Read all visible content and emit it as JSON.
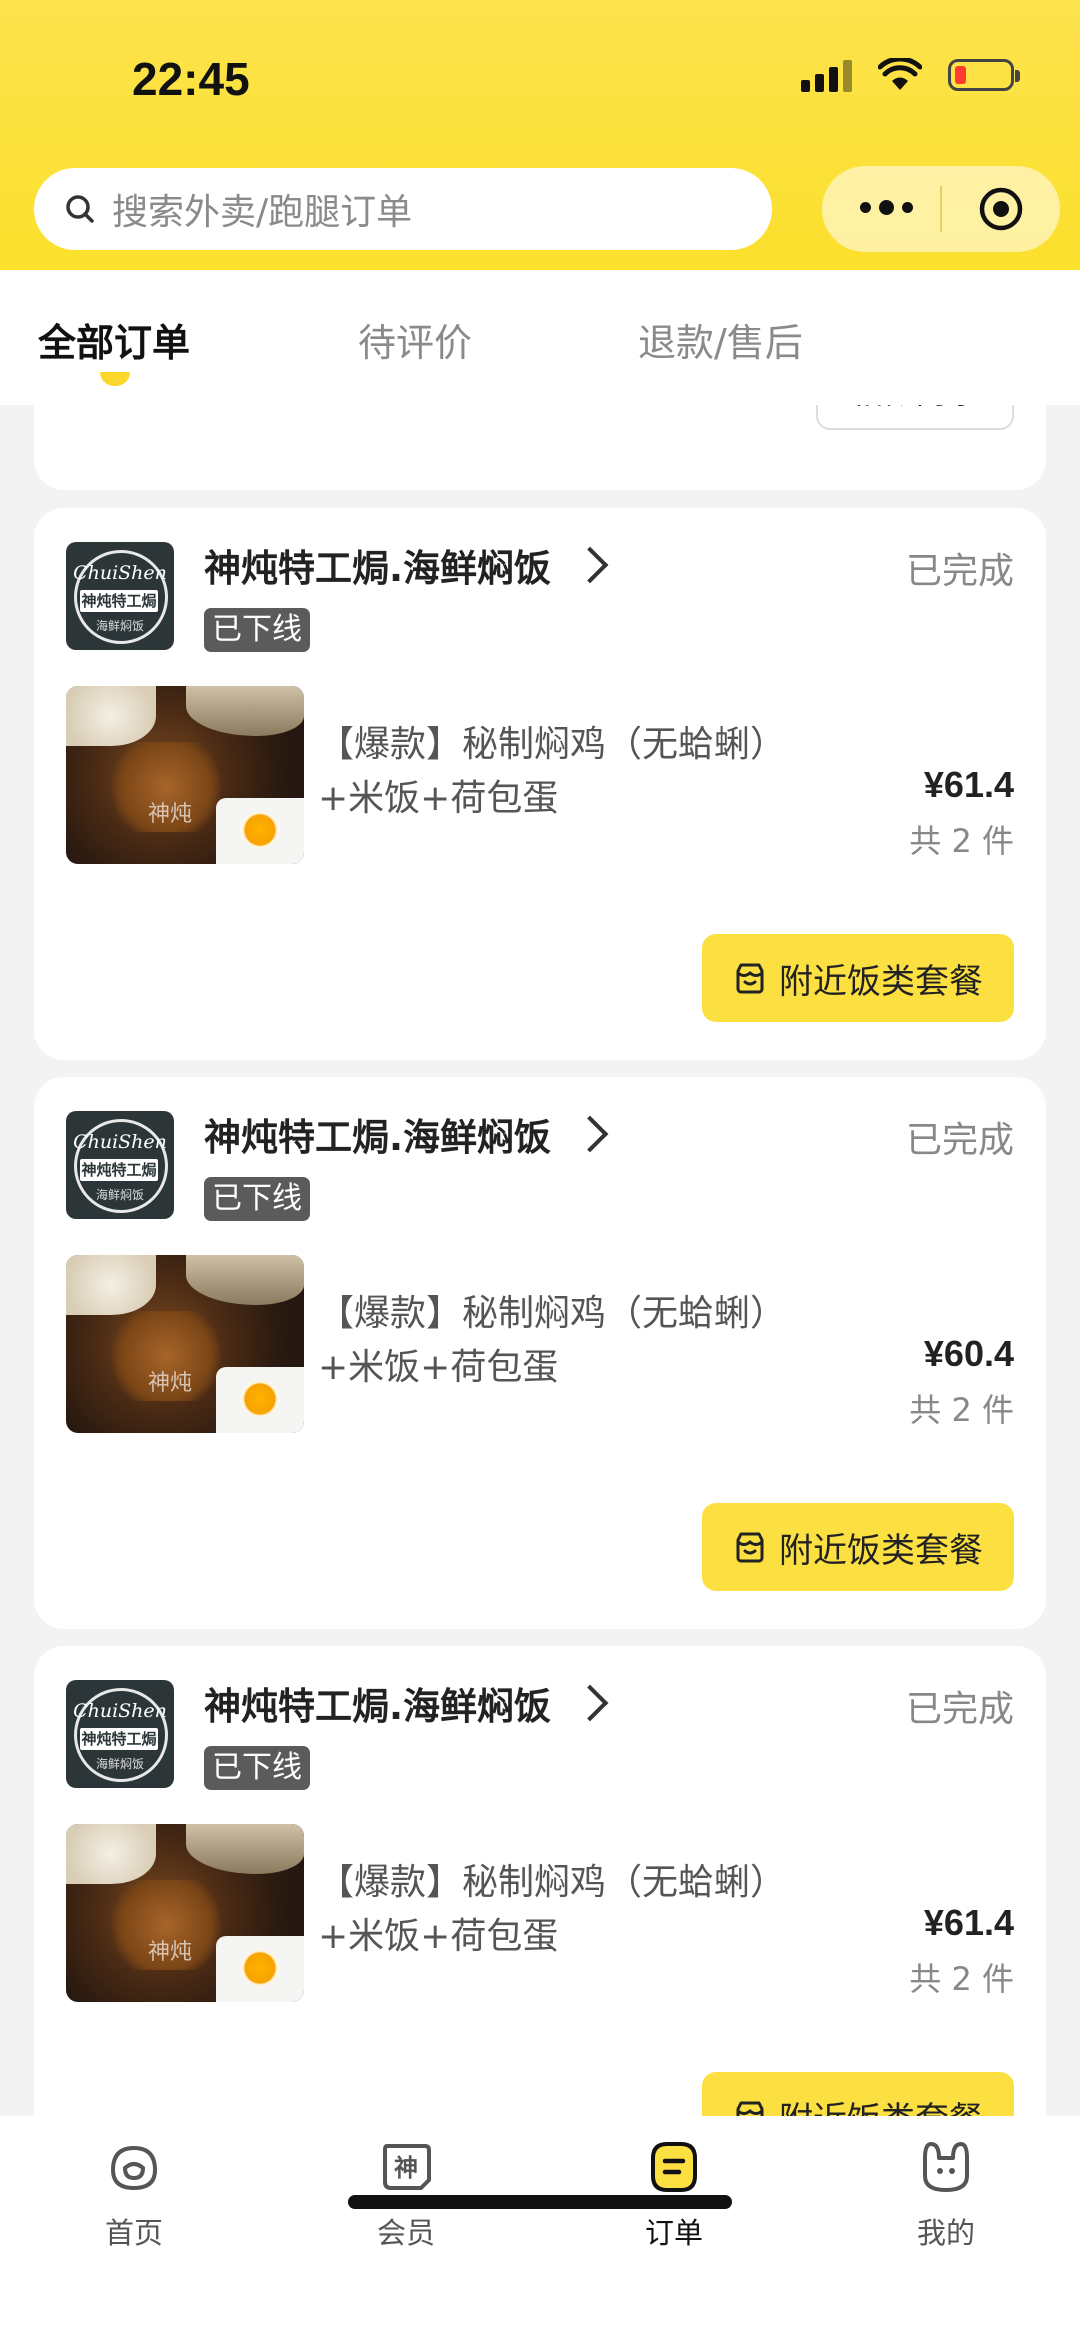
{
  "status_bar": {
    "time": "22:45"
  },
  "search": {
    "placeholder": "搜索外卖/跑腿订单"
  },
  "tabs": [
    {
      "label": "全部订单",
      "active": true
    },
    {
      "label": "待评价",
      "active": false
    },
    {
      "label": "退款/售后",
      "active": false
    }
  ],
  "previous_card": {
    "button_label": "相似商家"
  },
  "orders": [
    {
      "shop_name": "神炖特工焗.海鲜焖饭",
      "status": "已完成",
      "badge": "已下线",
      "logo": {
        "script": "ChuiShen",
        "name": "神炖特工焗",
        "sub": "海鲜焖饭"
      },
      "dish": "【爆款】秘制焖鸡（无蛤蜊）+米饭+荷包蛋",
      "thumb_watermark": "神炖",
      "price": "¥61.4",
      "quantity": "共 2 件",
      "action": "附近饭类套餐"
    },
    {
      "shop_name": "神炖特工焗.海鲜焖饭",
      "status": "已完成",
      "badge": "已下线",
      "logo": {
        "script": "ChuiShen",
        "name": "神炖特工焗",
        "sub": "海鲜焖饭"
      },
      "dish": "【爆款】秘制焖鸡（无蛤蜊）+米饭+荷包蛋",
      "thumb_watermark": "神炖",
      "price": "¥60.4",
      "quantity": "共 2 件",
      "action": "附近饭类套餐"
    },
    {
      "shop_name": "神炖特工焗.海鲜焖饭",
      "status": "已完成",
      "badge": "已下线",
      "logo": {
        "script": "ChuiShen",
        "name": "神炖特工焗",
        "sub": "海鲜焖饭"
      },
      "dish": "【爆款】秘制焖鸡（无蛤蜊）+米饭+荷包蛋",
      "thumb_watermark": "神炖",
      "price": "¥61.4",
      "quantity": "共 2 件",
      "action": "附近饭类套餐"
    }
  ],
  "bottom_nav": [
    {
      "label": "首页",
      "icon": "home-face-icon",
      "active": false
    },
    {
      "label": "会员",
      "icon": "member-shen-icon",
      "active": false
    },
    {
      "label": "订单",
      "icon": "order-list-icon",
      "active": true
    },
    {
      "label": "我的",
      "icon": "profile-rabbit-icon",
      "active": false
    }
  ],
  "colors": {
    "brand_yellow": "#fce042",
    "header_yellow": "#fbe02c",
    "offline_badge": "#5b5b5b"
  }
}
